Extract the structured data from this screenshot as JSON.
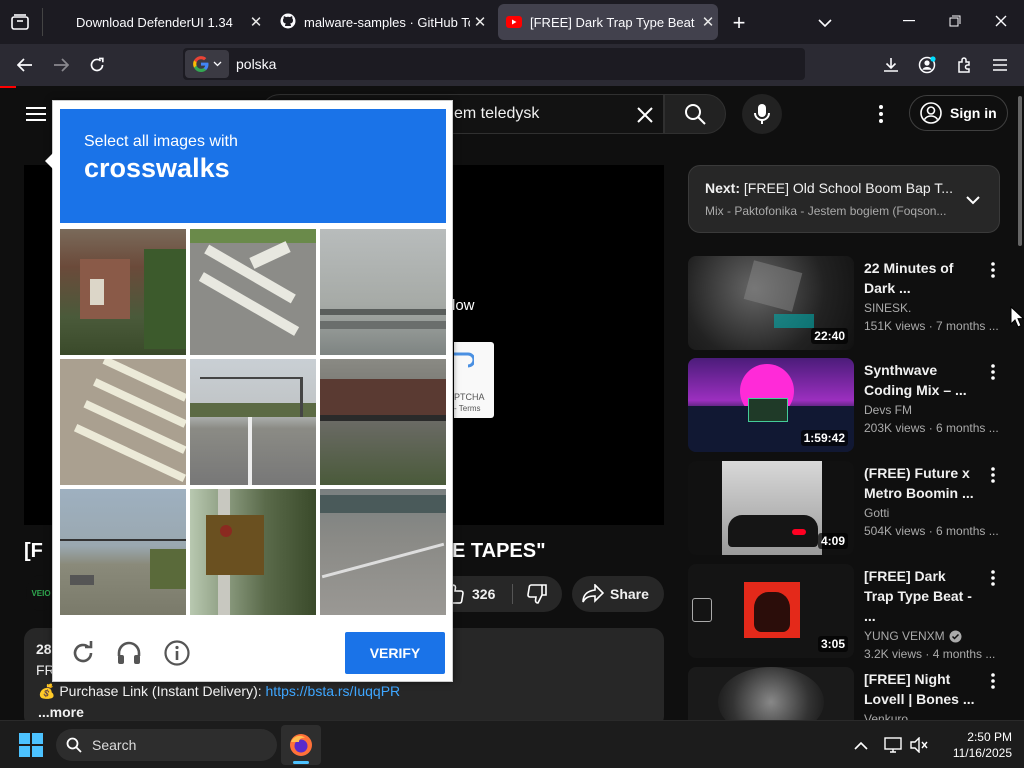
{
  "browser": {
    "tabs": [
      {
        "label": "Download DefenderUI 1.34",
        "active": false
      },
      {
        "label": "malware-samples · GitHub Topi",
        "active": false
      },
      {
        "label": "[FREE] Dark Trap Type Beat \"TH",
        "active": true
      }
    ],
    "url": "polska"
  },
  "youtube": {
    "search_value": "em teledysk",
    "sign_in": "Sign in",
    "next_label": "Next:",
    "next_title": "[FREE] Old School Boom Bap T...",
    "next_sub": "Mix - Paktofonika - Jestem bogiem (Foqson...",
    "video_title_left": "[F",
    "video_title_right": "E TAPES\"",
    "partial_text_low": "low",
    "recaptcha_line1": "PTCHA",
    "recaptcha_line2": "- Terms",
    "like_count": "326",
    "share": "Share",
    "desc_views": "28",
    "desc_fr": "FR",
    "purchase_label": "💰 Purchase Link (Instant Delivery): ",
    "purchase_link": "https://bsta.rs/IuqqPR",
    "more": "...more",
    "channel_partial": "VEIO",
    "recommendations": [
      {
        "title": "22 Minutes of Dark ...",
        "channel": "SINESK.",
        "meta": "151K views · 7 months ...",
        "duration": "22:40",
        "verified": false
      },
      {
        "title": "Synthwave Coding Mix – ...",
        "channel": "Devs FM",
        "meta": "203K views · 6 months ...",
        "duration": "1:59:42",
        "verified": false
      },
      {
        "title": "(FREE) Future x Metro Boomin ...",
        "channel": "Gotti",
        "meta": "504K views · 6 months ...",
        "duration": "4:09",
        "verified": false
      },
      {
        "title": "[FREE] Dark Trap Type Beat - ...",
        "channel": "YUNG VENXM",
        "meta": "3.2K views · 4 months ...",
        "duration": "3:05",
        "verified": true
      },
      {
        "title": "[FREE] Night Lovell | Bones ...",
        "channel": "Venkuro",
        "meta": "",
        "duration": "",
        "verified": false
      }
    ]
  },
  "captcha": {
    "instruction": "Select all images with",
    "target": "crosswalks",
    "verify": "VERIFY",
    "tiles": [
      "building-with-trees",
      "road-arrow-markings",
      "highway-guardrail",
      "crosswalk-stripes",
      "road-traffic-lights",
      "overpass-bridge",
      "intersection-traffic-lights",
      "traffic-signal-closeup",
      "road-curb"
    ]
  },
  "taskbar": {
    "search_placeholder": "Search",
    "time": "2:50 PM",
    "date": "11/16/2025"
  },
  "colors": {
    "accent": "#1a73e8",
    "link": "#3ea6ff",
    "tab_active": "#42414d"
  }
}
